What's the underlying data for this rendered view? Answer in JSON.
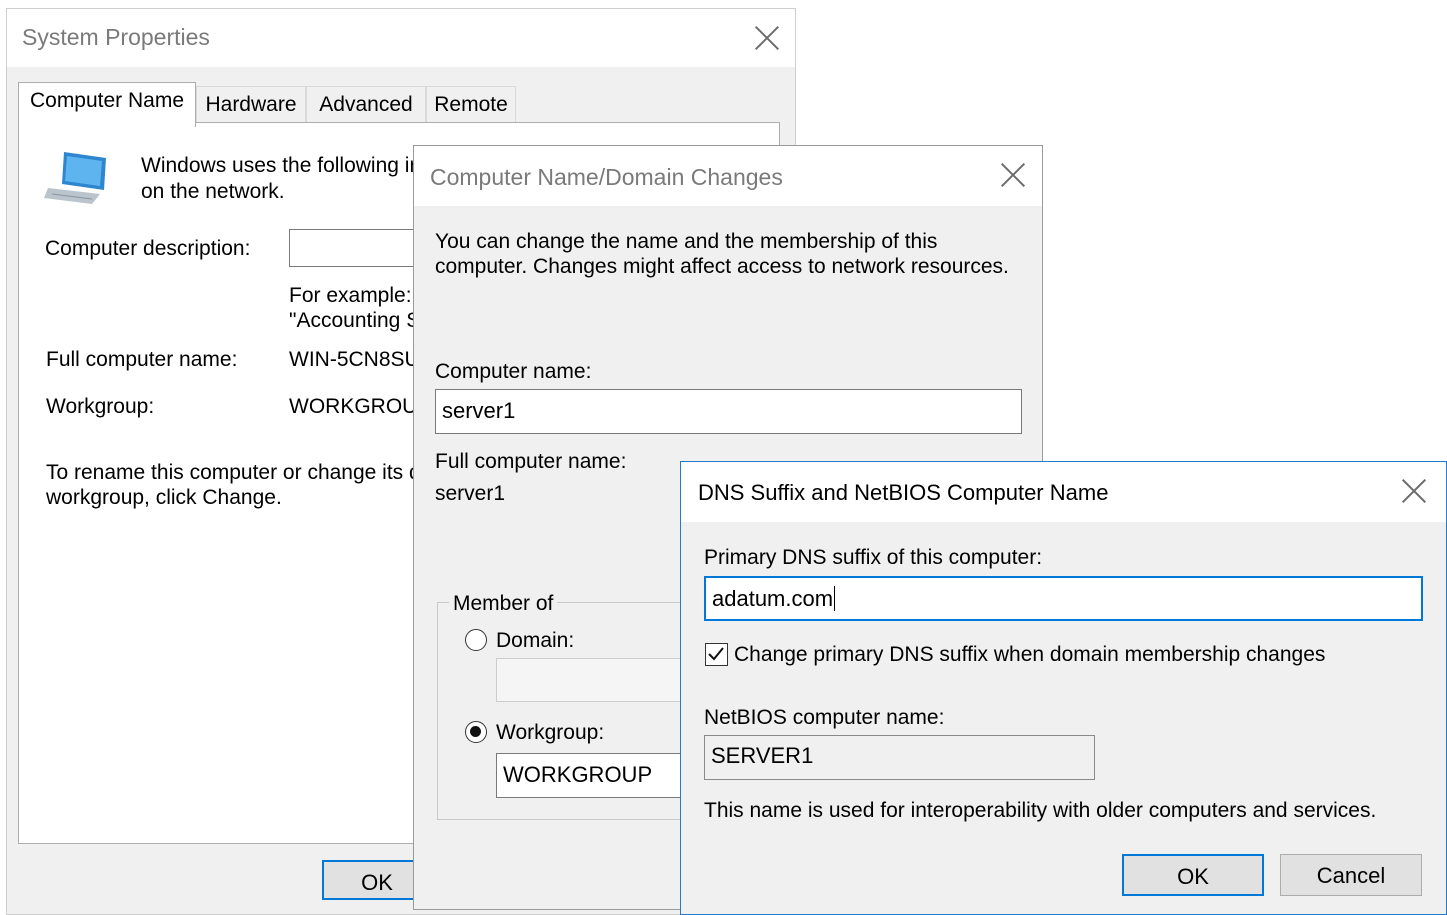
{
  "system_properties": {
    "title": "System Properties",
    "tabs": [
      "Computer Name",
      "Hardware",
      "Advanced",
      "Remote"
    ],
    "intro_line1": "Windows uses the following ir",
    "intro_line2": "on the network.",
    "computer_description_label": "Computer description:",
    "example_line1": "For example: '",
    "example_line2": "\"Accounting S",
    "full_computer_name_label": "Full computer name:",
    "full_computer_name_value": "WIN-5CN8SU",
    "workgroup_label": "Workgroup:",
    "workgroup_value": "WORKGROU",
    "rename_line1": "To rename this computer or change its d",
    "rename_line2": "workgroup, click Change.",
    "ok_label": "OK"
  },
  "domain_changes": {
    "title": "Computer Name/Domain Changes",
    "desc_line1": "You can change the name and the membership of this",
    "desc_line2": "computer. Changes might affect access to network resources.",
    "computer_name_label": "Computer name:",
    "computer_name_value": "server1",
    "full_computer_name_label": "Full computer name:",
    "full_computer_name_value": "server1",
    "member_of_label": "Member of",
    "domain_label": "Domain:",
    "domain_value": "",
    "workgroup_label": "Workgroup:",
    "workgroup_value": "WORKGROUP",
    "selected_membership": "workgroup"
  },
  "dns_suffix": {
    "title": "DNS Suffix and NetBIOS Computer Name",
    "primary_suffix_label": "Primary DNS suffix of this computer:",
    "primary_suffix_value": "adatum.com",
    "change_suffix_checkbox_label": "Change primary DNS suffix when domain membership changes",
    "change_suffix_checked": true,
    "netbios_label": "NetBIOS computer name:",
    "netbios_value": "SERVER1",
    "info_text": "This name is used for interoperability with older computers and services.",
    "ok_label": "OK",
    "cancel_label": "Cancel"
  },
  "colors": {
    "window_bg": "#f0f0f0",
    "accent_blue": "#0078d7",
    "border_gray": "#adadad"
  }
}
